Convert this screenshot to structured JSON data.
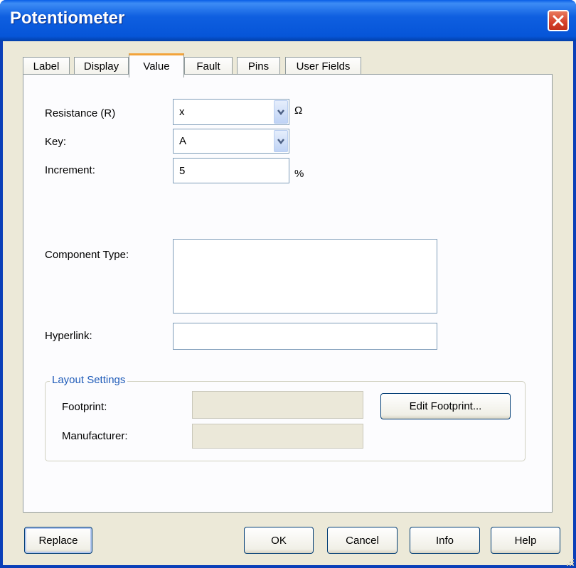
{
  "window": {
    "title": "Potentiometer"
  },
  "tabs": [
    {
      "label": "Label",
      "active": false
    },
    {
      "label": "Display",
      "active": false
    },
    {
      "label": "Value",
      "active": true
    },
    {
      "label": "Fault",
      "active": false
    },
    {
      "label": "Pins",
      "active": false
    },
    {
      "label": "User Fields",
      "active": false
    }
  ],
  "value_tab": {
    "resistance": {
      "label": "Resistance (R)",
      "value": "x",
      "unit": "Ω"
    },
    "key": {
      "label": "Key:",
      "value": "A"
    },
    "increment": {
      "label": "Increment:",
      "value": "5",
      "unit": "%"
    },
    "component_type": {
      "label": "Component Type:",
      "value": ""
    },
    "hyperlink": {
      "label": "Hyperlink:",
      "value": ""
    }
  },
  "layout_settings": {
    "legend": "Layout Settings",
    "footprint": {
      "label": "Footprint:",
      "value": ""
    },
    "manufacturer": {
      "label": "Manufacturer:",
      "value": ""
    },
    "edit_footprint_label": "Edit Footprint..."
  },
  "buttons": {
    "replace": "Replace",
    "ok": "OK",
    "cancel": "Cancel",
    "info": "Info",
    "help": "Help"
  },
  "icons": {
    "close": "close-icon",
    "dropdown": "chevron-down-icon",
    "resize": "resize-grip-icon"
  },
  "colors": {
    "titlebar": "#0655d8",
    "close": "#d5402a",
    "active_tab_accent": "#f2a33a",
    "group_legend": "#1d5ab8"
  }
}
